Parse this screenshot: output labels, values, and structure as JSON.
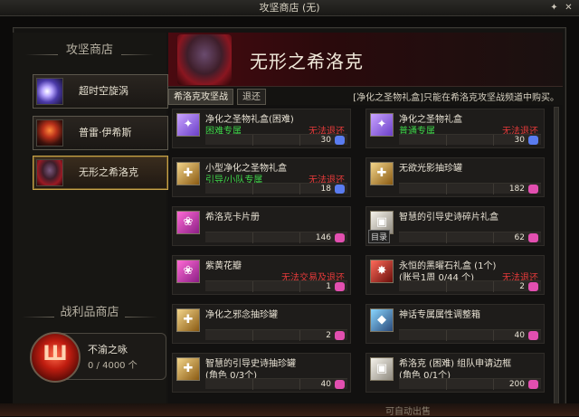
{
  "window": {
    "title": "攻坚商店 (无)"
  },
  "left": {
    "title": "攻坚商店",
    "shops": [
      {
        "label": "超时空旋涡",
        "active": false
      },
      {
        "label": "普雷·伊希斯",
        "active": false
      },
      {
        "label": "无形之希洛克",
        "active": true
      }
    ],
    "loot_title": "战利品商店",
    "medal": {
      "label": "不渝之咏",
      "count": "0 / 4000 个"
    }
  },
  "banner": {
    "title": "无形之希洛克"
  },
  "tabs": [
    {
      "label": "希洛克攻坚战",
      "active": true
    },
    {
      "label": "退还",
      "active": false
    }
  ],
  "notice": "[净化之圣物礼盒]只能在希洛克攻坚战频道中购买。",
  "items": [
    {
      "name": "净化之圣物礼盒(困难)",
      "sub": "困难专属",
      "sub_color": "#3fd64a",
      "warn": "无法退还",
      "price": "30",
      "coin": "blue",
      "icon": "purple"
    },
    {
      "name": "净化之圣物礼盒",
      "sub": "普通专属",
      "sub_color": "#3fd64a",
      "warn": "无法退还",
      "price": "30",
      "coin": "blue",
      "icon": "purple"
    },
    {
      "name": "小型净化之圣物礼盒",
      "sub": "引导/小队专属",
      "sub_color": "#3fd64a",
      "warn": "无法退还",
      "price": "18",
      "coin": "blue",
      "icon": "gold"
    },
    {
      "name": "无欲光影抽珍罐",
      "sub": "",
      "sub_color": "#e8e2d4",
      "warn": "",
      "price": "182",
      "coin": "pink",
      "icon": "gold"
    },
    {
      "name": "希洛克卡片册",
      "sub": "",
      "sub_color": "#e8e2d4",
      "warn": "",
      "price": "146",
      "coin": "pink",
      "icon": "magenta"
    },
    {
      "name": "智慧的引导史诗碎片礼盒",
      "sub": "",
      "sub_color": "#e8e2d4",
      "warn": "",
      "price": "62",
      "coin": "pink",
      "icon": "white",
      "tag": "目录"
    },
    {
      "name": "紫黄花瓣",
      "sub": "",
      "sub_color": "#e8e2d4",
      "warn": "无法交易及退还",
      "price": "1",
      "coin": "pink",
      "icon": "magenta"
    },
    {
      "name": "永恒的黑曜石礼盒 (1个)",
      "sub": "(账号1周 0/44 个)",
      "sub_color": "#e8e2d4",
      "warn": "无法退还",
      "price": "2",
      "coin": "pink",
      "icon": "red"
    },
    {
      "name": "净化之邪念抽珍罐",
      "sub": "",
      "sub_color": "#e8e2d4",
      "warn": "",
      "price": "2",
      "coin": "pink",
      "icon": "gold"
    },
    {
      "name": "神话专属属性调整箱",
      "sub": "",
      "sub_color": "#e8e2d4",
      "warn": "",
      "price": "40",
      "coin": "pink",
      "icon": "teal"
    },
    {
      "name": "智慧的引导史诗抽珍罐",
      "sub": "(角色 0/3个)",
      "sub_color": "#e8e2d4",
      "warn": "",
      "price": "40",
      "coin": "pink",
      "icon": "gold"
    },
    {
      "name": "希洛克 (困难) 组队申请边框",
      "sub": "(角色 0/1个)",
      "sub_color": "#e8e2d4",
      "warn": "",
      "price": "200",
      "coin": "pink",
      "icon": "white"
    }
  ],
  "footer": {
    "text": "可自动出售"
  },
  "colors": {
    "accent_gold": "#c6a24a",
    "warn_red": "#e53a3a",
    "green": "#3fd64a",
    "coin_blue": "#5a7cf0",
    "coin_pink": "#e24fb0"
  }
}
